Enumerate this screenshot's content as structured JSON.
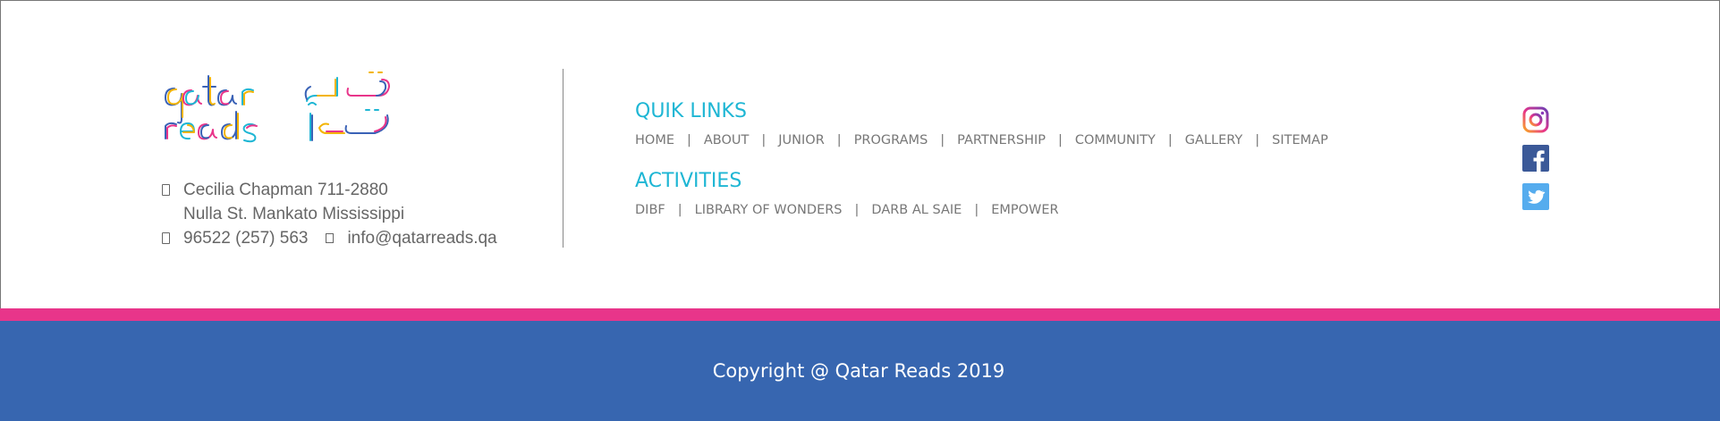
{
  "brand": {
    "logo_latin": "qatar reads",
    "logo_arabic": "قطر تقرأ"
  },
  "contact": {
    "address_line1": "Cecilia Chapman 711-2880",
    "address_line2": "Nulla St. Mankato Mississippi",
    "phone": "96522 (257) 563",
    "email": "info@qatarreads.qa",
    "address_icon": "address-icon",
    "phone_icon": "phone-icon",
    "email_icon": "email-icon"
  },
  "quick_links": {
    "title": "QUIK LINKS",
    "items": [
      "HOME",
      "ABOUT",
      "JUNIOR",
      "PROGRAMS",
      "PARTNERSHIP",
      "COMMUNITY",
      "GALLERY",
      "SITEMAP"
    ],
    "separator": "|"
  },
  "activities": {
    "title": "ACTIVITIES",
    "items": [
      "DIBF",
      "LIBRARY OF WONDERS",
      "DARB AL SAIE",
      "EMPOWER"
    ],
    "separator": "|"
  },
  "social": {
    "icons": [
      "instagram-icon",
      "facebook-icon",
      "twitter-icon"
    ],
    "colors": {
      "facebook": "#3b5998",
      "twitter": "#55acee",
      "instagram": "#c13584"
    }
  },
  "footer": {
    "copyright": "Copyright @ Qatar Reads 2019"
  },
  "colors": {
    "accent": "#1eb6d4",
    "pink_bar": "#e8358a",
    "bottom_bar": "#3766b0",
    "text_gray": "#777777"
  }
}
